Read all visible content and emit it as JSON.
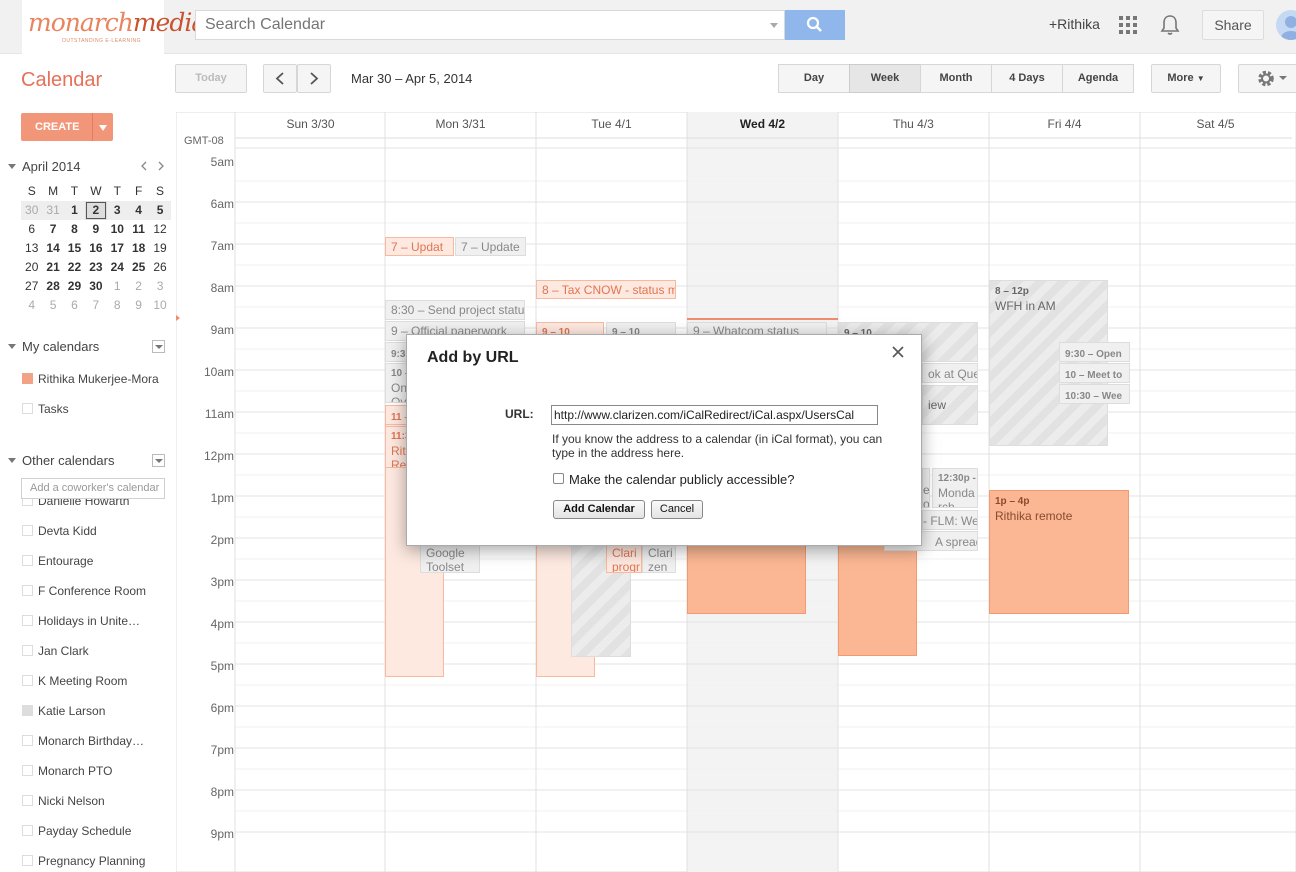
{
  "brand": {
    "logo_word_a": "monarch",
    "logo_word_b": "media",
    "logo_tagline": "OUTSTANDING E-LEARNING"
  },
  "topbar": {
    "search_placeholder": "Search Calendar",
    "user": "+Rithika",
    "share_label": "Share"
  },
  "toolbar": {
    "title": "Calendar",
    "today_label": "Today",
    "date_range": "Mar 30 – Apr 5, 2014",
    "views": [
      "Day",
      "Week",
      "Month",
      "4 Days",
      "Agenda"
    ],
    "selected_view": "Week",
    "more_label": "More"
  },
  "sidebar": {
    "create_label": "CREATE",
    "mini_month": "April 2014",
    "weekday_initials": [
      "S",
      "M",
      "T",
      "W",
      "T",
      "F",
      "S"
    ],
    "weeks": [
      [
        "30",
        "31",
        "1",
        "2",
        "3",
        "4",
        "5"
      ],
      [
        "6",
        "7",
        "8",
        "9",
        "10",
        "11",
        "12"
      ],
      [
        "13",
        "14",
        "15",
        "16",
        "17",
        "18",
        "19"
      ],
      [
        "20",
        "21",
        "22",
        "23",
        "24",
        "25",
        "26"
      ],
      [
        "27",
        "28",
        "29",
        "30",
        "1",
        "2",
        "3"
      ],
      [
        "4",
        "5",
        "6",
        "7",
        "8",
        "9",
        "10"
      ]
    ],
    "my_calendars_label": "My calendars",
    "my_calendars": [
      {
        "name": "Rithika Mukerjee-Mora",
        "color": "#f2a385"
      },
      {
        "name": "Tasks",
        "color": "#ffffff"
      }
    ],
    "other_calendars_label": "Other calendars",
    "coworker_placeholder": "Add a coworker's calendar",
    "other_calendars": [
      {
        "name": "Danielle Howarth",
        "color": "#ffffff"
      },
      {
        "name": "Devta Kidd",
        "color": "#ffffff"
      },
      {
        "name": "Entourage",
        "color": "#ffffff"
      },
      {
        "name": "F Conference Room",
        "color": "#ffffff"
      },
      {
        "name": "Holidays in Unite…",
        "color": "#ffffff"
      },
      {
        "name": "Jan Clark",
        "color": "#ffffff"
      },
      {
        "name": "K Meeting Room",
        "color": "#ffffff"
      },
      {
        "name": "Katie Larson",
        "color": "#dddddd"
      },
      {
        "name": "Monarch Birthday…",
        "color": "#ffffff"
      },
      {
        "name": "Monarch PTO",
        "color": "#ffffff"
      },
      {
        "name": "Nicki Nelson",
        "color": "#ffffff"
      },
      {
        "name": "Payday Schedule",
        "color": "#ffffff"
      },
      {
        "name": "Pregnancy Planning",
        "color": "#ffffff"
      }
    ]
  },
  "grid": {
    "timezone": "GMT-08",
    "days": [
      "Sun 3/30",
      "Mon 3/31",
      "Tue 4/1",
      "Wed 4/2",
      "Thu 4/3",
      "Fri 4/4",
      "Sat 4/5"
    ],
    "today_index": 3,
    "hours": [
      "5am",
      "6am",
      "7am",
      "8am",
      "9am",
      "10am",
      "11am",
      "12pm",
      "1pm",
      "2pm",
      "3pm",
      "4pm",
      "5pm",
      "6pm",
      "7pm",
      "8pm",
      "9pm"
    ]
  },
  "events": {
    "mon_update": "7 – Updat",
    "mon_update2": "7 – Update",
    "mon_send": "8:30 – Send project statu",
    "mon_official": "9 – Official paperwork",
    "mon_930": "9:30",
    "mon_10": "10 –",
    "mon_on": "On",
    "mon_ov": "Ov",
    "mon_11": "11 –",
    "mon_1130": "11:3",
    "mon_rit": "Rit",
    "mon_re": "Re",
    "mon_google": "Google",
    "mon_toolset": "Toolset",
    "tue_tax": "8 – Tax CNOW - status m",
    "tue_910a": "9 – 10",
    "tue_910b": "9 – 10",
    "tue_clari1": "Clari",
    "tue_progr": "progr",
    "tue_clari2": "Clari",
    "tue_zen": "zen",
    "wed_whatcom": "9 – Whatcom status",
    "thu_910": "9 – 10",
    "thu_queue": "ok at Queu",
    "thu_view": "iew",
    "thu_1230": "12:30p -",
    "thu_monda": "Monda",
    "thu_rch": "rch",
    "thu_e": "e",
    "thu_o": "o",
    "thu_flm": "- FLM: We",
    "thu_spread": "A spreads",
    "fri_wfh_time": "8 – 12p",
    "fri_wfh": "WFH in AM",
    "fri_open": "9:30 – Open",
    "fri_meet": "10 – Meet to",
    "fri_wee": "10:30 – Wee",
    "fri_remote_time": "1p – 4p",
    "fri_remote": "Rithika remote"
  },
  "dialog": {
    "title": "Add by URL",
    "url_label": "URL:",
    "url_value": "http://www.clarizen.com/iCalRedirect/iCal.aspx/UsersCal",
    "hint": "If you know the address to a calendar (in iCal format), you can type in the address here.",
    "public_label": "Make the calendar publicly accessible?",
    "add_label": "Add Calendar",
    "cancel_label": "Cancel"
  },
  "colors": {
    "accent": "#e67158",
    "create": "#f2967a",
    "event_orange": "#fbb793",
    "search_button": "#8fb7ec"
  }
}
